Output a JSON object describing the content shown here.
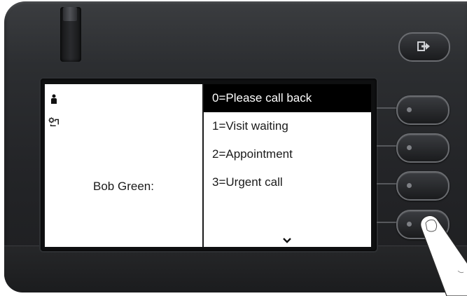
{
  "caller": {
    "name": "Bob Green:"
  },
  "menu": {
    "items": [
      {
        "label": "0=Please call back",
        "selected": true
      },
      {
        "label": "1=Visit waiting",
        "selected": false
      },
      {
        "label": "2=Appointment",
        "selected": false
      },
      {
        "label": "3=Urgent call",
        "selected": false
      }
    ],
    "more_indicator": "chevron-down-icon"
  },
  "icons": {
    "status_top": "person-icon",
    "status_second": "settings-phone-icon",
    "top_key": "exit-icon"
  },
  "colors": {
    "selection_background": "#000000",
    "selection_text": "#ffffff",
    "screen_background": "#ffffff",
    "phone_body": "#2c2e31"
  }
}
